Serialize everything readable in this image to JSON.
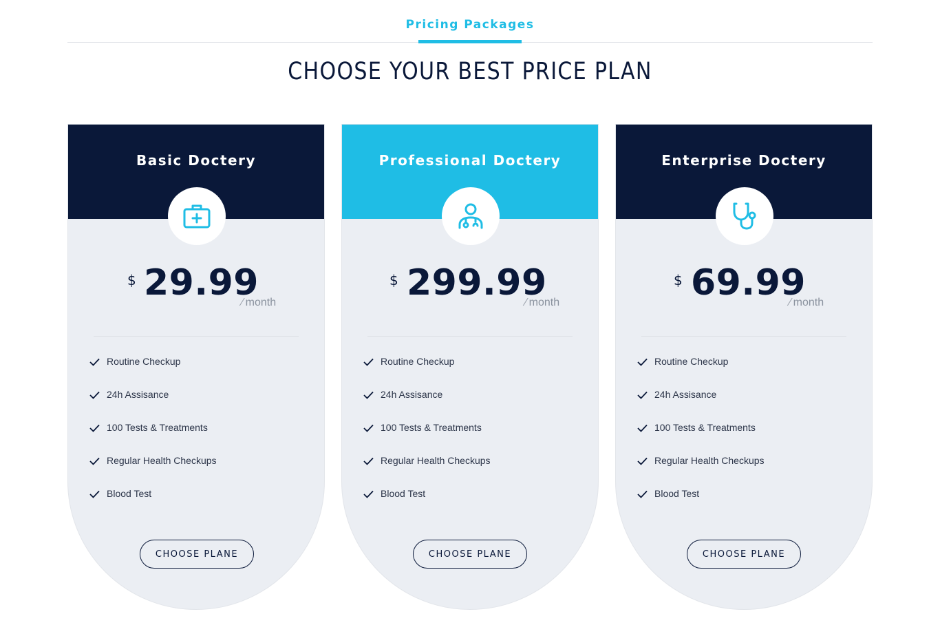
{
  "section": {
    "eyebrow": "Pricing Packages",
    "headline": "CHOOSE YOUR BEST PRICE PLAN"
  },
  "colors": {
    "navy": "#0a1839",
    "accent": "#1fbde5",
    "card_bg": "#ebeef3"
  },
  "plans": [
    {
      "title": "Basic Doctery",
      "icon": "first-aid-kit-icon",
      "currency": "$",
      "price": "29.99",
      "period": "month",
      "features": [
        "Routine Checkup",
        "24h Assisance",
        "100 Tests & Treatments",
        "Regular Health Checkups",
        "Blood Test"
      ],
      "button_label": "CHOOSE PLANE"
    },
    {
      "title": "Professional Doctery",
      "icon": "doctor-icon",
      "currency": "$",
      "price": "299.99",
      "period": "month",
      "features": [
        "Routine Checkup",
        "24h Assisance",
        "100 Tests & Treatments",
        "Regular Health Checkups",
        "Blood Test"
      ],
      "button_label": "CHOOSE PLANE"
    },
    {
      "title": "Enterprise Doctery",
      "icon": "stethoscope-icon",
      "currency": "$",
      "price": "69.99",
      "period": "month",
      "features": [
        "Routine Checkup",
        "24h Assisance",
        "100 Tests & Treatments",
        "Regular Health Checkups",
        "Blood Test"
      ],
      "button_label": "CHOOSE PLANE"
    }
  ]
}
